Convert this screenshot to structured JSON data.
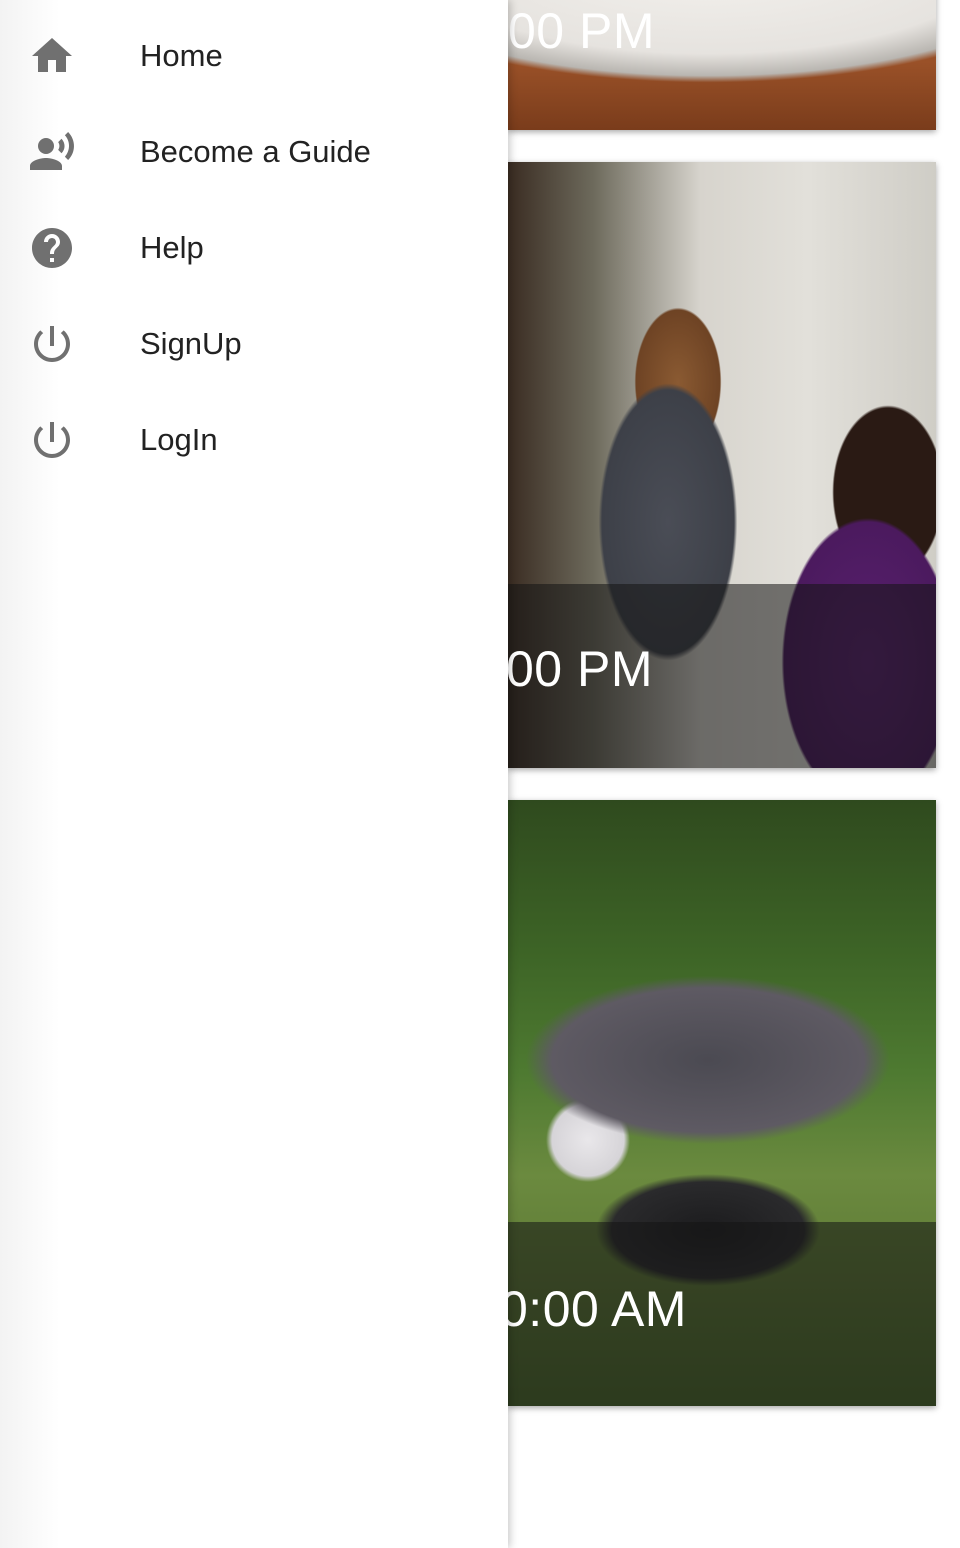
{
  "drawer": {
    "items": [
      {
        "label": "Home",
        "icon": "home-icon"
      },
      {
        "label": "Become a Guide",
        "icon": "record-voice-icon"
      },
      {
        "label": "Help",
        "icon": "help-icon"
      },
      {
        "label": "SignUp",
        "icon": "power-icon"
      },
      {
        "label": "LogIn",
        "icon": "power-icon"
      }
    ]
  },
  "tours": [
    {
      "time": "00 PM"
    },
    {
      "time": "00 PM"
    },
    {
      "time": "0:00 AM"
    }
  ],
  "colors": {
    "icon": "#707070",
    "label": "#222222",
    "drawer_bg": "#ffffff"
  }
}
